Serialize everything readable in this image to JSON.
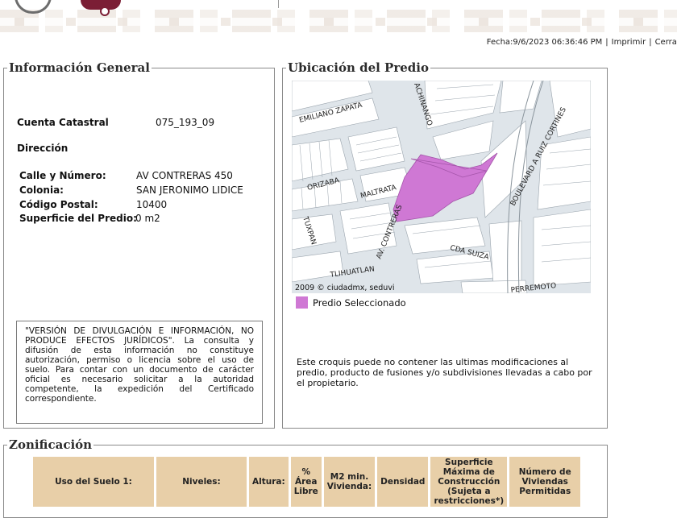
{
  "header": {
    "fecha": "Fecha:9/6/2023 06:36:46 PM",
    "print_label": "Imprimir",
    "close_label": "Cerrar"
  },
  "info_general": {
    "legend": "Información General",
    "cuenta_label": "Cuenta Catastral",
    "cuenta_value": "075_193_09",
    "direccion_label": "Dirección",
    "calle_label": "Calle y Número:",
    "calle_value": "AV CONTRERAS 450",
    "colonia_label": "Colonia:",
    "colonia_value": "SAN JERONIMO LIDICE",
    "cp_label": "Código Postal:",
    "cp_value": "10400",
    "superficie_label": "Superficie del Predio:",
    "superficie_value": "0 m2",
    "disclaimer": "\"VERSIÓN DE DIVULGACIÓN E INFORMACIÓN, NO PRODUCE EFECTOS JURÍDICOS\". La consulta y difusión de esta información no constituye autorización, permiso o licencia sobre el uso de suelo. Para contar con un documento de carácter oficial es necesario solicitar a la autoridad competente, la expedición del Certificado correspondiente."
  },
  "ubicacion": {
    "legend": "Ubicación del Predio",
    "map_credit": "2009 © ciudadmx, seduvi",
    "streets": {
      "emiliano": "EMILIANO ZAPATA",
      "achinango": "ACHINANGO",
      "boulevard": "BOULEVARD A RUIZ CORTINES",
      "orizaba": "ORIZABA",
      "maltrata": "MALTRATA",
      "contreras": "AV. CONTRERAS",
      "tuxpan": "TUXPAN",
      "suiza": "CDA SUIZA",
      "tlihuatlan": "TLIHUATLAN",
      "perremoto": "PERREMOTO"
    },
    "legend_label": "Predio Seleccionado",
    "note": "Este croquis puede no contener las ultimas modificaciones al predio, producto de fusiones y/o subdivisiones llevadas a cabo por el propietario.",
    "colors": {
      "predio": "#cf78d4",
      "block": "#ffffff",
      "street": "#dfe5ea"
    }
  },
  "zonificacion": {
    "legend": "Zonificación",
    "headers": [
      "Uso del Suelo 1:",
      "Niveles:",
      "Altura:",
      "% Área Libre",
      "M2 min. Vivienda:",
      "Densidad",
      "Superficie Máxima de Construcción (Sujeta a restricciones*)",
      "Número de Viviendas Permitidas"
    ],
    "header_color": "#e8cfa8"
  }
}
